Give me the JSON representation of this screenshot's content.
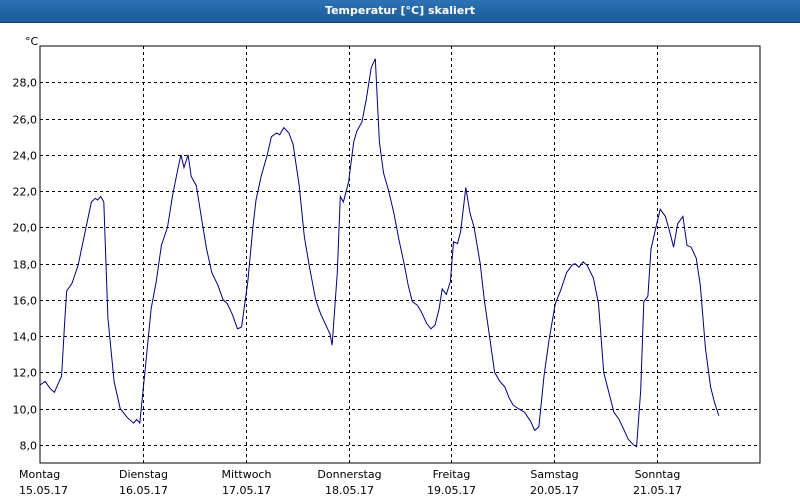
{
  "window": {
    "title": "Temperatur [°C] skaliert"
  },
  "chart_data": {
    "type": "line",
    "title": "Temperatur [°C] skaliert",
    "ylabel": "°C",
    "ylim": [
      7,
      30
    ],
    "xlim": [
      0,
      7
    ],
    "yticks": [
      8.0,
      10.0,
      12.0,
      14.0,
      16.0,
      18.0,
      20.0,
      22.0,
      24.0,
      26.0,
      28.0
    ],
    "ytick_labels": [
      "8,0",
      "10,0",
      "12,0",
      "14,0",
      "16,0",
      "18,0",
      "20,0",
      "22,0",
      "24,0",
      "26,0",
      "28,0"
    ],
    "xticks": [
      {
        "day": "Montag",
        "date": "15.05.17"
      },
      {
        "day": "Dienstag",
        "date": "16.05.17"
      },
      {
        "day": "Mittwoch",
        "date": "17.05.17"
      },
      {
        "day": "Donnerstag",
        "date": "18.05.17"
      },
      {
        "day": "Freitag",
        "date": "19.05.17"
      },
      {
        "day": "Samstag",
        "date": "20.05.17"
      },
      {
        "day": "Sonntag",
        "date": "21.05.17"
      }
    ],
    "grid": true,
    "line_color": "#000080",
    "series": [
      {
        "points": [
          [
            0.0,
            11.3
          ],
          [
            0.05,
            11.5
          ],
          [
            0.1,
            11.1
          ],
          [
            0.14,
            10.9
          ],
          [
            0.21,
            11.8
          ],
          [
            0.24,
            14.8
          ],
          [
            0.26,
            16.5
          ],
          [
            0.31,
            16.9
          ],
          [
            0.37,
            17.9
          ],
          [
            0.44,
            19.8
          ],
          [
            0.5,
            21.4
          ],
          [
            0.54,
            21.6
          ],
          [
            0.56,
            21.5
          ],
          [
            0.59,
            21.7
          ],
          [
            0.62,
            21.4
          ],
          [
            0.66,
            15.0
          ],
          [
            0.72,
            11.5
          ],
          [
            0.78,
            10.0
          ],
          [
            0.85,
            9.5
          ],
          [
            0.91,
            9.2
          ],
          [
            0.94,
            9.4
          ],
          [
            0.97,
            9.2
          ],
          [
            1.02,
            12.0
          ],
          [
            1.08,
            15.5
          ],
          [
            1.13,
            17.0
          ],
          [
            1.18,
            19.0
          ],
          [
            1.24,
            20.0
          ],
          [
            1.29,
            21.8
          ],
          [
            1.34,
            23.2
          ],
          [
            1.37,
            24.0
          ],
          [
            1.4,
            23.3
          ],
          [
            1.44,
            24.0
          ],
          [
            1.47,
            22.8
          ],
          [
            1.52,
            22.3
          ],
          [
            1.57,
            20.5
          ],
          [
            1.62,
            18.8
          ],
          [
            1.67,
            17.5
          ],
          [
            1.73,
            16.8
          ],
          [
            1.78,
            16.0
          ],
          [
            1.82,
            15.8
          ],
          [
            1.87,
            15.2
          ],
          [
            1.92,
            14.4
          ],
          [
            1.96,
            14.5
          ],
          [
            2.02,
            17.0
          ],
          [
            2.07,
            20.0
          ],
          [
            2.1,
            21.5
          ],
          [
            2.15,
            22.8
          ],
          [
            2.21,
            24.0
          ],
          [
            2.25,
            25.0
          ],
          [
            2.3,
            25.2
          ],
          [
            2.33,
            25.1
          ],
          [
            2.37,
            25.5
          ],
          [
            2.42,
            25.2
          ],
          [
            2.46,
            24.6
          ],
          [
            2.52,
            22.3
          ],
          [
            2.57,
            19.5
          ],
          [
            2.62,
            17.8
          ],
          [
            2.68,
            16.0
          ],
          [
            2.73,
            15.2
          ],
          [
            2.78,
            14.6
          ],
          [
            2.82,
            14.1
          ],
          [
            2.84,
            13.5
          ],
          [
            2.89,
            17.5
          ],
          [
            2.92,
            21.7
          ],
          [
            2.95,
            21.4
          ],
          [
            3.0,
            22.5
          ],
          [
            3.05,
            24.7
          ],
          [
            3.08,
            25.3
          ],
          [
            3.13,
            25.8
          ],
          [
            3.17,
            27.0
          ],
          [
            3.22,
            28.8
          ],
          [
            3.26,
            29.3
          ],
          [
            3.3,
            24.7
          ],
          [
            3.34,
            23.0
          ],
          [
            3.39,
            22.0
          ],
          [
            3.44,
            20.8
          ],
          [
            3.49,
            19.3
          ],
          [
            3.54,
            18.0
          ],
          [
            3.58,
            16.8
          ],
          [
            3.62,
            15.9
          ],
          [
            3.67,
            15.7
          ],
          [
            3.71,
            15.3
          ],
          [
            3.76,
            14.7
          ],
          [
            3.8,
            14.4
          ],
          [
            3.84,
            14.6
          ],
          [
            3.88,
            15.5
          ],
          [
            3.91,
            16.6
          ],
          [
            3.95,
            16.3
          ],
          [
            3.99,
            17.0
          ],
          [
            4.02,
            19.2
          ],
          [
            4.06,
            19.1
          ],
          [
            4.09,
            19.8
          ],
          [
            4.14,
            22.2
          ],
          [
            4.18,
            20.8
          ],
          [
            4.22,
            20.0
          ],
          [
            4.28,
            18.0
          ],
          [
            4.32,
            16.0
          ],
          [
            4.37,
            14.0
          ],
          [
            4.42,
            12.0
          ],
          [
            4.47,
            11.5
          ],
          [
            4.52,
            11.2
          ],
          [
            4.56,
            10.6
          ],
          [
            4.6,
            10.2
          ],
          [
            4.65,
            10.0
          ],
          [
            4.71,
            9.8
          ],
          [
            4.77,
            9.3
          ],
          [
            4.81,
            8.8
          ],
          [
            4.85,
            9.0
          ],
          [
            4.9,
            11.8
          ],
          [
            4.95,
            13.8
          ],
          [
            5.01,
            15.8
          ],
          [
            5.06,
            16.5
          ],
          [
            5.12,
            17.5
          ],
          [
            5.17,
            17.9
          ],
          [
            5.2,
            18.0
          ],
          [
            5.24,
            17.8
          ],
          [
            5.28,
            18.1
          ],
          [
            5.32,
            17.9
          ],
          [
            5.38,
            17.2
          ],
          [
            5.43,
            15.8
          ],
          [
            5.48,
            12.0
          ],
          [
            5.53,
            10.9
          ],
          [
            5.58,
            9.8
          ],
          [
            5.63,
            9.4
          ],
          [
            5.68,
            8.8
          ],
          [
            5.72,
            8.3
          ],
          [
            5.77,
            8.0
          ],
          [
            5.8,
            7.9
          ],
          [
            5.84,
            11.0
          ],
          [
            5.87,
            15.9
          ],
          [
            5.91,
            16.2
          ],
          [
            5.94,
            18.8
          ],
          [
            5.98,
            19.8
          ],
          [
            6.03,
            21.0
          ],
          [
            6.08,
            20.6
          ],
          [
            6.12,
            19.8
          ],
          [
            6.16,
            18.9
          ],
          [
            6.2,
            20.2
          ],
          [
            6.25,
            20.6
          ],
          [
            6.29,
            19.0
          ],
          [
            6.33,
            18.9
          ],
          [
            6.38,
            18.3
          ],
          [
            6.42,
            16.8
          ],
          [
            6.47,
            13.3
          ],
          [
            6.52,
            11.2
          ],
          [
            6.56,
            10.3
          ],
          [
            6.6,
            9.6
          ]
        ]
      }
    ]
  }
}
